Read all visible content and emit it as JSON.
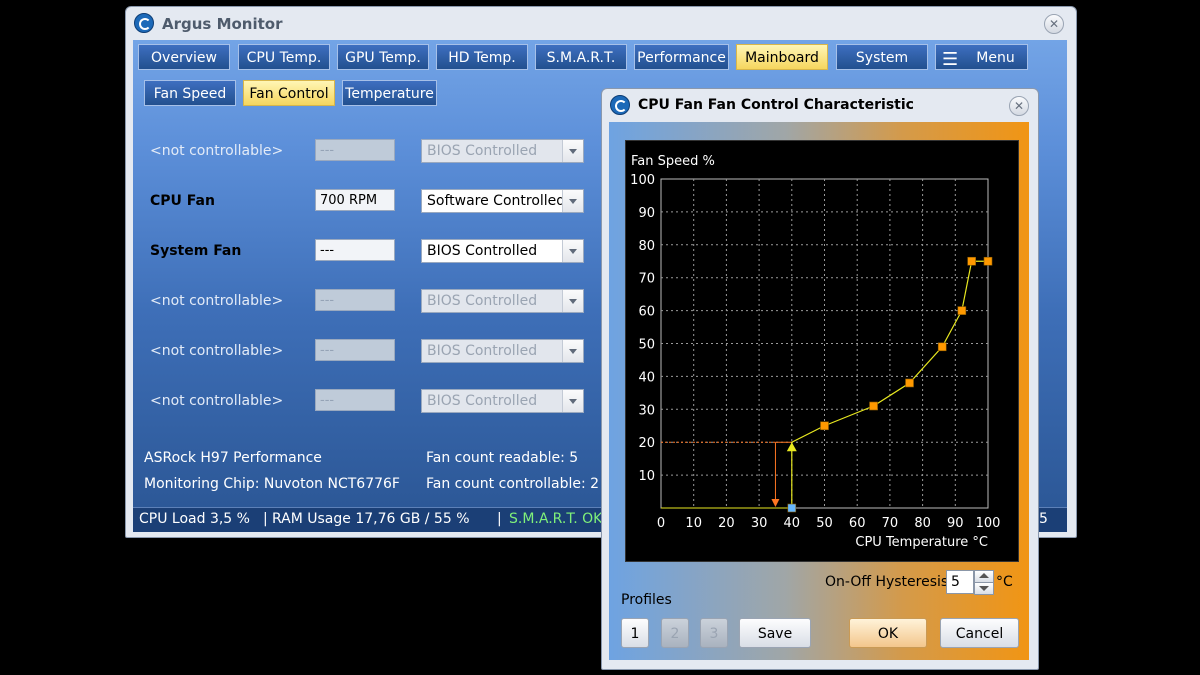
{
  "app": {
    "title": "Argus Monitor"
  },
  "tabs": [
    "Overview",
    "CPU Temp.",
    "GPU Temp.",
    "HD Temp.",
    "S.M.A.R.T.",
    "Performance",
    "Mainboard",
    "System",
    "Menu"
  ],
  "subtabs": [
    "Fan Speed",
    "Fan Control",
    "Temperature"
  ],
  "fans": [
    {
      "name": "<not controllable>",
      "rpm": "---",
      "mode": "BIOS Controlled"
    },
    {
      "name": "CPU Fan",
      "rpm": "700 RPM",
      "mode": "Software Controlled"
    },
    {
      "name": "System Fan",
      "rpm": "---",
      "mode": "BIOS Controlled"
    },
    {
      "name": "<not controllable>",
      "rpm": "---",
      "mode": "BIOS Controlled"
    },
    {
      "name": "<not controllable>",
      "rpm": "---",
      "mode": "BIOS Controlled"
    },
    {
      "name": "<not controllable>",
      "rpm": "---",
      "mode": "BIOS Controlled"
    }
  ],
  "info": {
    "board": "ASRock H97 Performance",
    "chip": "Monitoring Chip: Nuvoton NCT6776F",
    "readable": "Fan count readable: 5",
    "controllable": "Fan count controllable: 2"
  },
  "status": {
    "cpu": "CPU Load 3,5 %",
    "ram": "RAM Usage 17,76 GB / 55 %",
    "smart": "S.M.A.R.T. OK",
    "tail": "5"
  },
  "dialog": {
    "title": "CPU Fan Fan Control Characteristic",
    "hysteresis_label": "On-Off Hysteresis",
    "hysteresis_value": "5",
    "hysteresis_unit": "°C",
    "profiles_label": "Profiles",
    "profiles": [
      "1",
      "2",
      "3"
    ],
    "save": "Save",
    "ok": "OK",
    "cancel": "Cancel"
  },
  "chart_data": {
    "type": "line",
    "ylabel": "Fan Speed %",
    "xlabel": "CPU Temperature °C",
    "xlim": [
      0,
      100
    ],
    "ylim": [
      0,
      100
    ],
    "xticks": [
      0,
      10,
      20,
      30,
      40,
      50,
      60,
      70,
      80,
      90,
      100
    ],
    "yticks": [
      10,
      20,
      30,
      40,
      50,
      60,
      70,
      80,
      90,
      100
    ],
    "grid": true,
    "points": [
      [
        40,
        0
      ],
      [
        40,
        20
      ],
      [
        50,
        25
      ],
      [
        65,
        31
      ],
      [
        76,
        38
      ],
      [
        86,
        49
      ],
      [
        92,
        60
      ],
      [
        95,
        75
      ],
      [
        100,
        75
      ]
    ],
    "hysteresis": {
      "on_temp": 40,
      "off_temp": 35,
      "speed": 20
    },
    "colors": {
      "curve": "#e8e820",
      "point": "#ff9900",
      "hysteresis": "#ff7722",
      "start_point": "#66b8ff"
    }
  }
}
